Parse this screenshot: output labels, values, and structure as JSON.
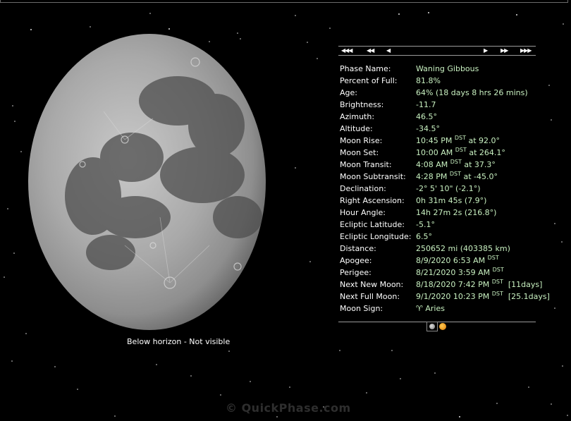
{
  "moon_caption": "Below horizon - Not visible",
  "nav": {
    "first": "◀◀◀",
    "prev_fast": "◀◀",
    "prev": "◀",
    "next": "▶",
    "next_fast": "▶▶",
    "last": "▶▶▶"
  },
  "rows": [
    {
      "label": "Phase Name:",
      "value": "Waning Gibbous"
    },
    {
      "label": "Percent of Full:",
      "value": "81.8%"
    },
    {
      "label": "Age:",
      "value": "64% (18 days 8 hrs 26 mins)"
    },
    {
      "label": "Brightness:",
      "value": "-11.7"
    },
    {
      "label": "Azimuth:",
      "value": "46.5°"
    },
    {
      "label": "Altitude:",
      "value": "-34.5°"
    },
    {
      "label": "Moon Rise:",
      "value": "10:45 PM",
      "sup": "DST",
      "after": " at 92.0°"
    },
    {
      "label": "Moon Set:",
      "value": "10:00 AM",
      "sup": "DST",
      "after": " at 264.1°"
    },
    {
      "label": "Moon Transit:",
      "value": "4:08 AM",
      "sup": "DST",
      "after": " at 37.3°"
    },
    {
      "label": "Moon Subtransit:",
      "value": "4:28 PM",
      "sup": "DST",
      "after": " at -45.0°"
    },
    {
      "label": "Declination:",
      "value": "-2° 5' 10\" (-2.1°)"
    },
    {
      "label": "Right Ascension:",
      "value": "0h 31m 45s (7.9°)"
    },
    {
      "label": "Hour Angle:",
      "value": "14h 27m 2s (216.8°)"
    },
    {
      "label": "Ecliptic Latitude:",
      "value": "-5.1°"
    },
    {
      "label": "Ecliptic Longitude:",
      "value": "6.5°"
    },
    {
      "label": "Distance:",
      "value": "250652 mi (403385 km)"
    },
    {
      "label": "Apogee:",
      "value": "8/9/2020 6:53 AM",
      "sup": "DST",
      "after": ""
    },
    {
      "label": "Perigee:",
      "value": "8/21/2020 3:59 AM",
      "sup": "DST",
      "after": ""
    },
    {
      "label": "Next New Moon:",
      "value": "8/18/2020 7:42 PM",
      "sup": "DST",
      "after": "  [11days]"
    },
    {
      "label": "Next Full Moon:",
      "value": "9/1/2020 10:23 PM",
      "sup": "DST",
      "after": "  [25.1days]"
    },
    {
      "label": "Moon Sign:",
      "value": "♈ Aries"
    }
  ],
  "watermark": "© QuickPhase.com",
  "colors": {
    "background": "#000000",
    "value_text": "#c8f0c0",
    "label_text": "#ffffff",
    "rule": "#9a9a9a"
  }
}
